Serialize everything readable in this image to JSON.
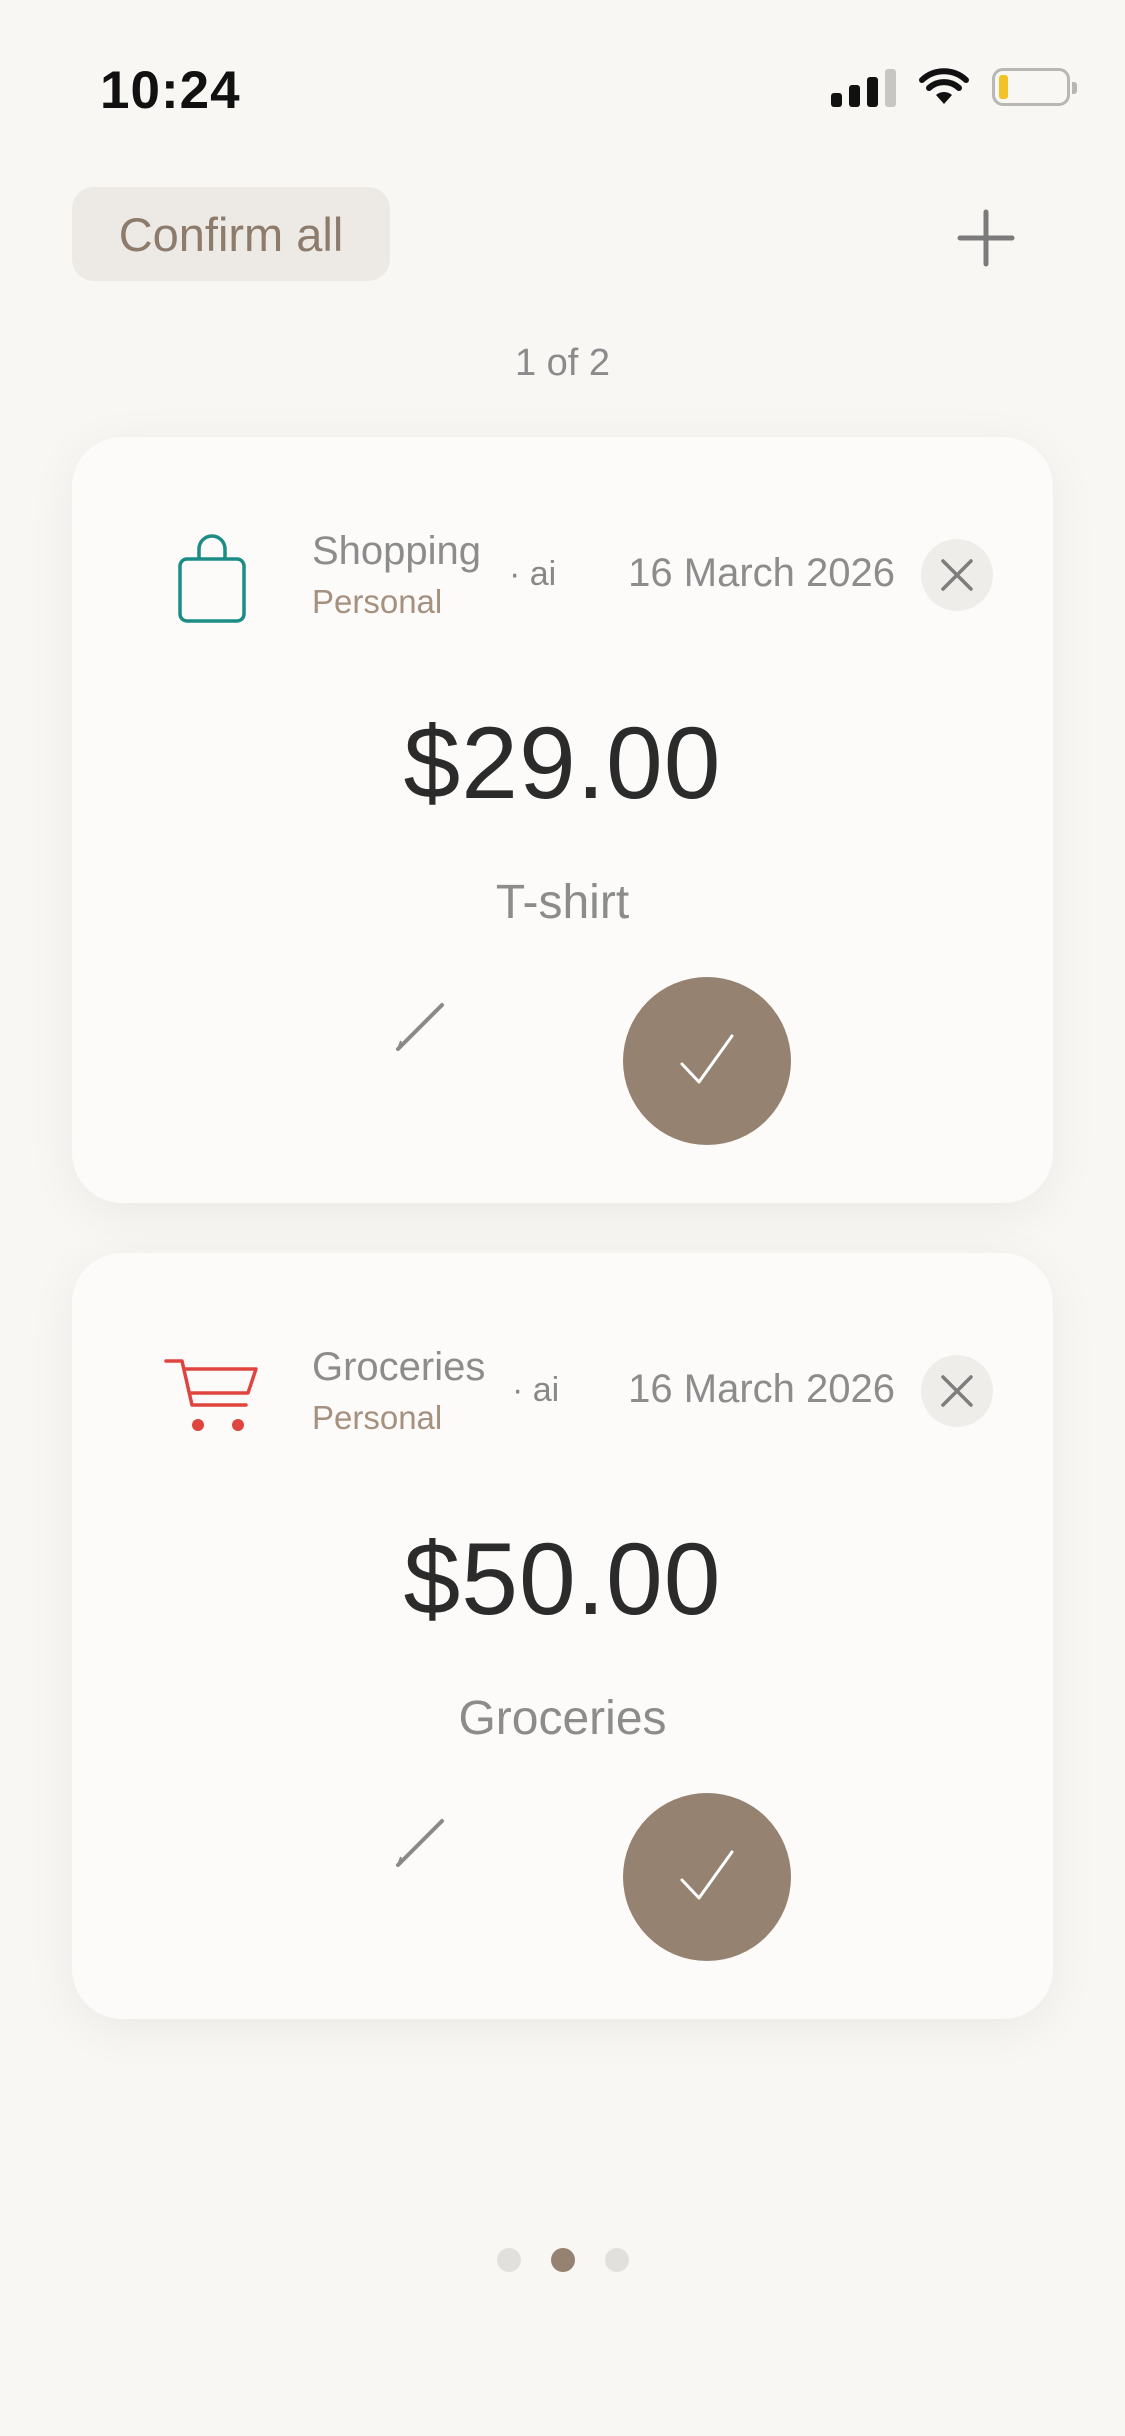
{
  "status_bar": {
    "time": "10:24",
    "icons": [
      "cellular-signal-icon",
      "wifi-icon",
      "battery-low-icon"
    ],
    "battery_color": "#f2c227"
  },
  "header": {
    "confirm_all_label": "Confirm all",
    "add_icon": "plus-icon",
    "counter": "1 of 2"
  },
  "cards": [
    {
      "category": "Shopping",
      "subcategory": "Personal",
      "source": "· ai",
      "date": "16 March 2026",
      "amount": "$29.00",
      "description": "T-shirt",
      "icon": "shopping-bag-icon",
      "icon_color": "#1b8c86"
    },
    {
      "category": "Groceries",
      "subcategory": "Personal",
      "source": "· ai",
      "date": "16 March 2026",
      "amount": "$50.00",
      "description": "Groceries",
      "icon": "shopping-cart-icon",
      "icon_color": "#e0443e"
    }
  ],
  "pagination": {
    "total": 3,
    "active_index": 1
  },
  "colors": {
    "background": "#f9f7f4",
    "accent": "#958270",
    "card": "#fcfbf9"
  }
}
